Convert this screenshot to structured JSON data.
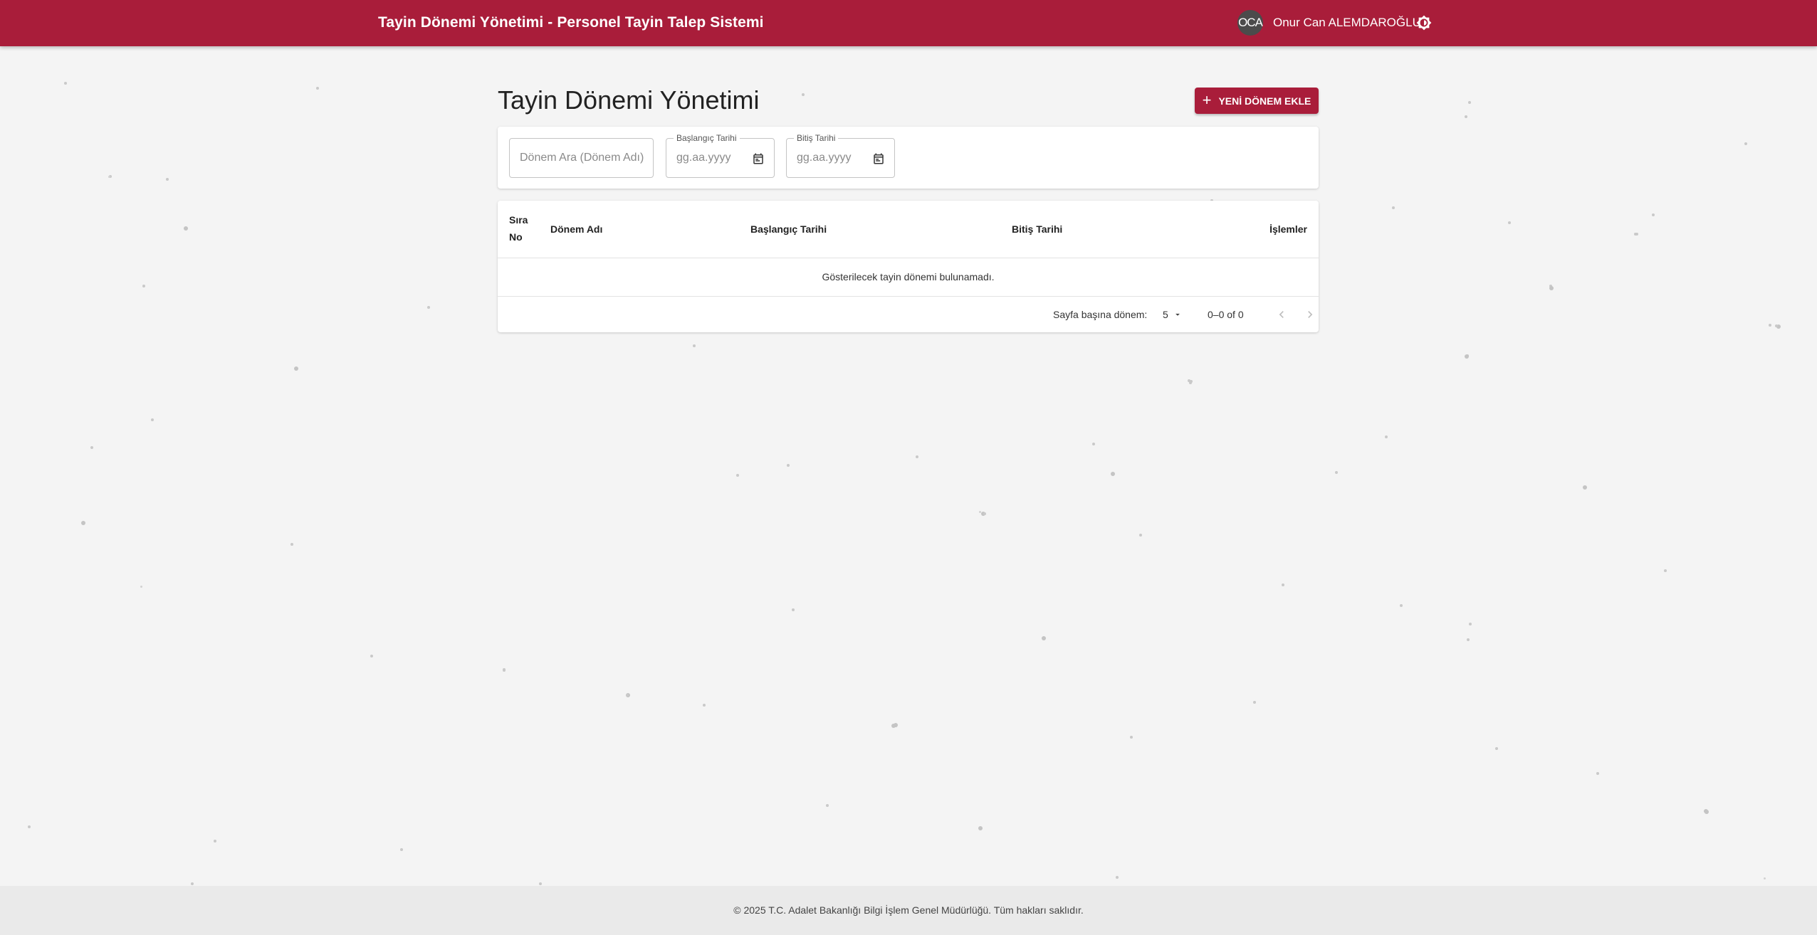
{
  "header": {
    "title": "Tayin Dönemi Yönetimi - Personel Tayin Talep Sistemi",
    "avatar_initials": "OCA",
    "user_name": "Onur Can ALEMDAROĞLU",
    "theme_icon": "brightness-icon"
  },
  "page": {
    "title": "Tayin Dönemi Yönetimi",
    "add_button_label": "YENİ DÖNEM EKLE"
  },
  "filters": {
    "search_placeholder": "Dönem Ara (Dönem Adı)",
    "start_label": "Başlangıç Tarihi",
    "start_placeholder": "gg.aa.yyyy",
    "end_label": "Bitiş Tarihi",
    "end_placeholder": "gg.aa.yyyy"
  },
  "table": {
    "columns": {
      "no_line1": "Sıra",
      "no_line2": "No",
      "name": "Dönem Adı",
      "start": "Başlangıç Tarihi",
      "end": "Bitiş Tarihi",
      "actions": "İşlemler"
    },
    "empty_message": "Gösterilecek tayin dönemi bulunamadı."
  },
  "pagination": {
    "rows_per_page_label": "Sayfa başına dönem:",
    "rows_per_page_value": "5",
    "range": "0–0 of 0"
  },
  "footer": {
    "text": "© 2025 T.C. Adalet Bakanlığı Bilgi İşlem Genel Müdürlüğü. Tüm hakları saklıdır."
  },
  "colors": {
    "primary": "#a91d3a",
    "background": "#f4f4f4",
    "footer_bg": "#eaeaea"
  }
}
